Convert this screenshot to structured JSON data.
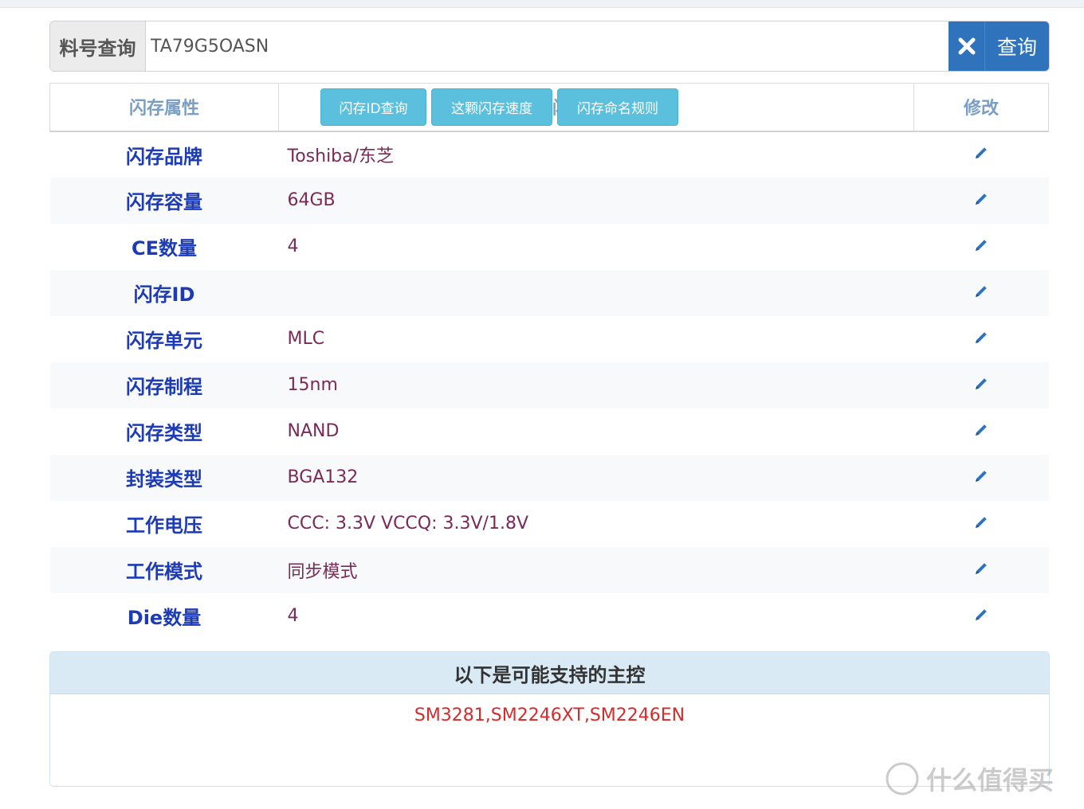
{
  "search": {
    "label": "料号查询",
    "value": "TA79G5OASN",
    "button_label": "查询"
  },
  "table": {
    "headers": [
      "闪存属性",
      "闪存属性值",
      "修改"
    ],
    "rows": [
      {
        "prop": "闪存品牌",
        "value": "Toshiba/东芝"
      },
      {
        "prop": "闪存容量",
        "value": "64GB"
      },
      {
        "prop": "CE数量",
        "value": "4"
      },
      {
        "prop": "闪存ID",
        "value": ""
      },
      {
        "prop": "闪存单元",
        "value": "MLC"
      },
      {
        "prop": "闪存制程",
        "value": "15nm"
      },
      {
        "prop": "闪存类型",
        "value": "NAND"
      },
      {
        "prop": "封装类型",
        "value": "BGA132"
      },
      {
        "prop": "工作电压",
        "value": "CCC: 3.3V VCCQ: 3.3V/1.8V"
      },
      {
        "prop": "工作模式",
        "value": "同步模式"
      },
      {
        "prop": "Die数量",
        "value": "4"
      }
    ]
  },
  "controllers": {
    "title": "以下是可能支持的主控",
    "list": "SM3281,SM2246XT,SM2246EN",
    "buttons": [
      "闪存ID查询",
      "这颗闪存速度",
      "闪存命名规则"
    ]
  },
  "watermark": {
    "text": "什么值得买",
    "logo_char": "值"
  },
  "colors": {
    "accent_blue": "#2f73bd",
    "prop_text": "#1d3bb5",
    "value_text": "#7a2a57",
    "controller_red": "#d52b2b",
    "info_button": "#5bc0de"
  }
}
